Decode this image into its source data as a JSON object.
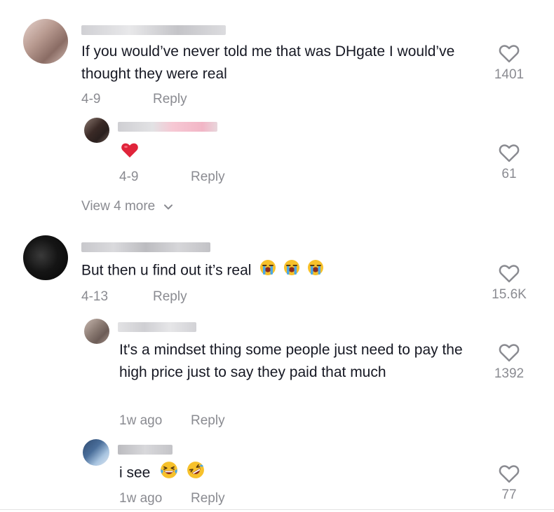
{
  "comments": [
    {
      "text": "If you would’ve never told me that was DHgate I would’ve thought they were real",
      "date": "4-9",
      "reply_label": "Reply",
      "likes": "1401",
      "avatar_colors": [
        "#d8c0b8",
        "#8a6c64",
        "#b89a90",
        "#e6d2cc"
      ],
      "replies": [
        {
          "text": "",
          "emoji": "red-heart",
          "date": "4-9",
          "reply_label": "Reply",
          "likes": "61",
          "avatar_colors": [
            "#3a2a26",
            "#6e5a52",
            "#2a201e",
            "#8c7a72"
          ]
        }
      ],
      "view_more": "View 4 more"
    },
    {
      "text": "But then u find out it’s real",
      "emoji": [
        "loudly-crying-face",
        "loudly-crying-face",
        "loudly-crying-face"
      ],
      "date": "4-13",
      "reply_label": "Reply",
      "likes": "15.6K",
      "avatar_colors": [
        "#101010",
        "#2a2a2a",
        "#050505",
        "#3a3a3a"
      ],
      "replies": [
        {
          "text": "It's a mindset thing some people just need to pay the high price just to say they paid that much",
          "date": "1w ago",
          "reply_label": "Reply",
          "likes": "1392",
          "avatar_colors": [
            "#8a7a72",
            "#c8b8b0",
            "#6c5c56",
            "#a8968e"
          ]
        },
        {
          "text": "i see",
          "emoji": [
            "grinning-squinting-face",
            "rolling-on-floor-laughing-face"
          ],
          "date": "1w ago",
          "reply_label": "Reply",
          "likes": "77",
          "avatar_colors": [
            "#4a6e9a",
            "#a8c4e0",
            "#2e4a70",
            "#dfe8f2"
          ]
        }
      ]
    }
  ],
  "colors": {
    "text": "#161823",
    "muted": "#8a8b91",
    "heart_red": "#e0243a",
    "emoji_yellow": "#f7c12b"
  }
}
